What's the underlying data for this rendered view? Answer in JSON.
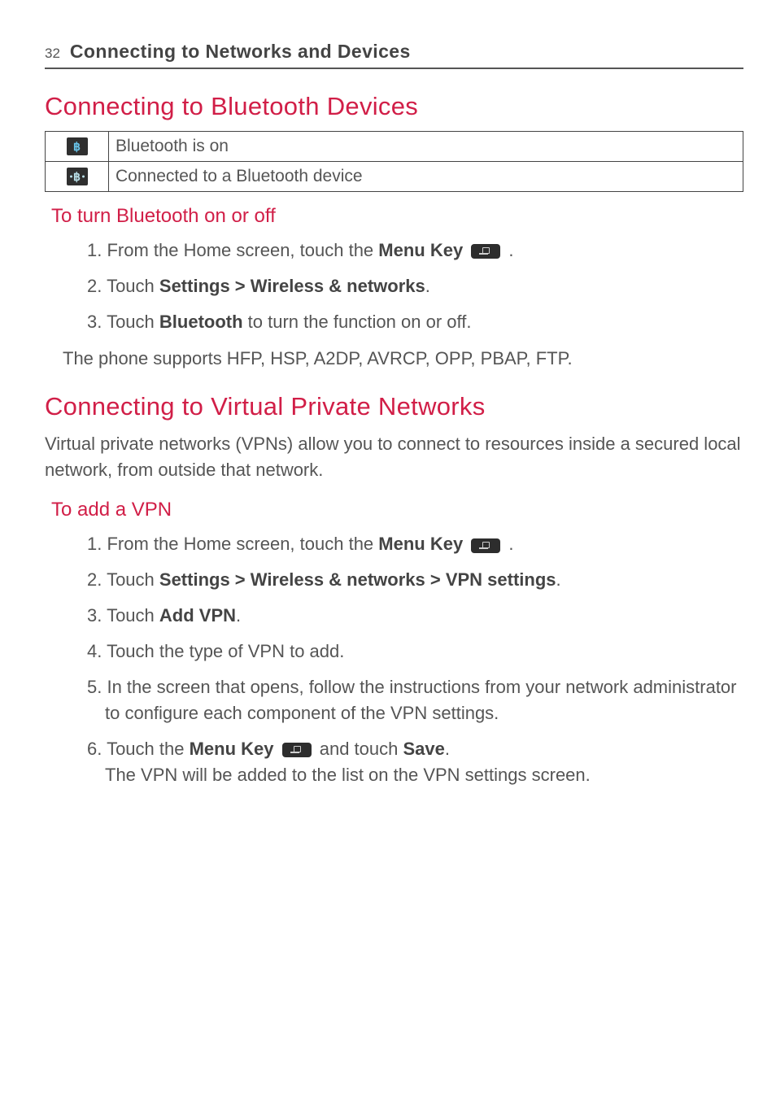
{
  "header": {
    "page_number": "32",
    "chapter_title": "Connecting to Networks and Devices"
  },
  "section1": {
    "title": "Connecting to Bluetooth Devices",
    "table": {
      "row1_text": "Bluetooth is on",
      "row2_text": "Connected to a Bluetooth device"
    },
    "subheading": "To turn Bluetooth on or off",
    "step1_pre": "1. From the Home screen, touch the ",
    "step1_bold": "Menu Key ",
    "step1_post": " .",
    "step2_pre": "2. Touch ",
    "step2_bold": "Settings > Wireless & networks",
    "step2_post": ".",
    "step3_pre": "3. Touch ",
    "step3_bold": "Bluetooth",
    "step3_post": " to turn the function on or off.",
    "support_line": "The phone supports HFP, HSP, A2DP, AVRCP, OPP, PBAP, FTP."
  },
  "section2": {
    "title": "Connecting to Virtual Private Networks",
    "intro": "Virtual private networks (VPNs) allow you to connect to resources inside a secured local network, from outside that network.",
    "subheading": "To add a VPN",
    "step1_pre": "1. From the Home screen, touch the ",
    "step1_bold": "Menu Key ",
    "step1_post": " .",
    "step2_pre": "2. Touch ",
    "step2_bold": "Settings > Wireless & networks > VPN settings",
    "step2_post": ".",
    "step3_pre": "3. Touch ",
    "step3_bold": "Add VPN",
    "step3_post": ".",
    "step4": "4. Touch the type of VPN to add.",
    "step5": "5. In the screen that opens, follow the instructions from your network administrator to configure each component of the VPN settings.",
    "step6_pre": "6. Touch the ",
    "step6_bold1": "Menu Key ",
    "step6_mid": " and touch ",
    "step6_bold2": "Save",
    "step6_post": ".",
    "step6_line2": "The VPN will be added to the list on the VPN settings screen."
  }
}
